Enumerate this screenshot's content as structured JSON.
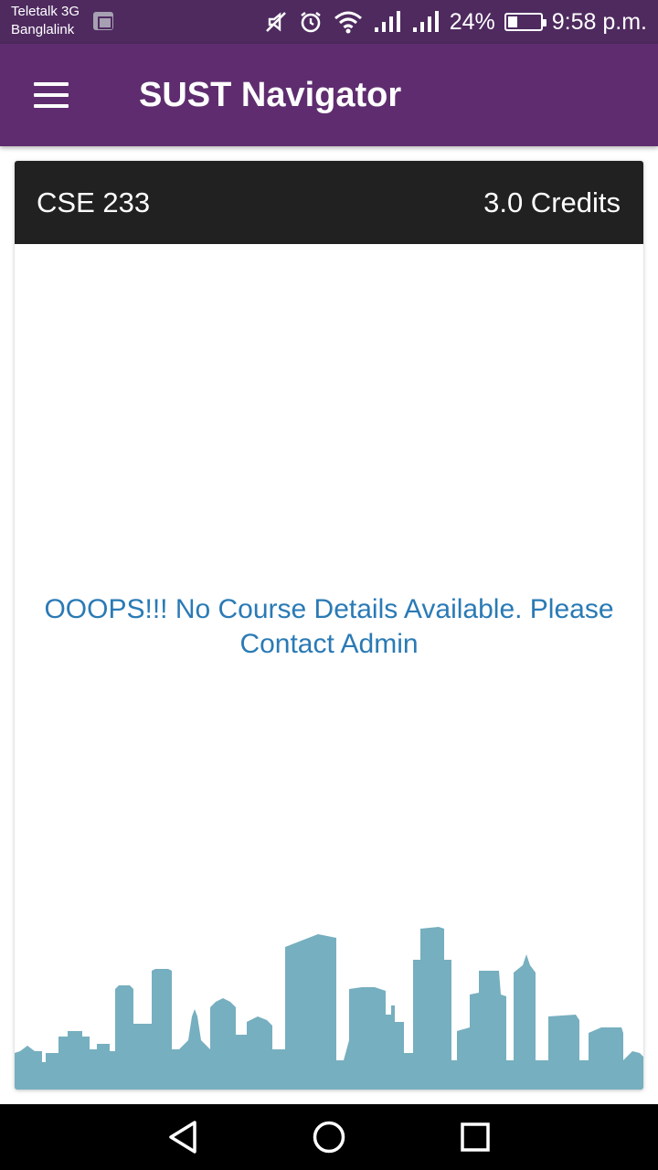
{
  "status_bar": {
    "carrier_primary": "Teletalk 3G",
    "carrier_secondary": "Banglalink",
    "battery_percent": "24%",
    "time": "9:58 p.m.",
    "icons": [
      "image-icon",
      "mute-icon",
      "alarm-icon",
      "wifi-icon",
      "signal-icon",
      "signal-icon",
      "battery-icon"
    ]
  },
  "app_bar": {
    "title": "SUST Navigator",
    "menu_icon": "menu-icon",
    "background": "#5f2d6f"
  },
  "course": {
    "code": "CSE 233",
    "credits": "3.0 Credits",
    "message": "OOOPS!!! No Course Details Available. Please Contact Admin",
    "illustration": "city-skyline"
  },
  "colors": {
    "status_bar": "#4e2a5f",
    "card_header": "#212121",
    "message_text": "#2a7ab5",
    "skyline": "#76afbf"
  },
  "nav_bar": {
    "buttons": [
      "back-icon",
      "home-icon",
      "recents-icon"
    ]
  }
}
